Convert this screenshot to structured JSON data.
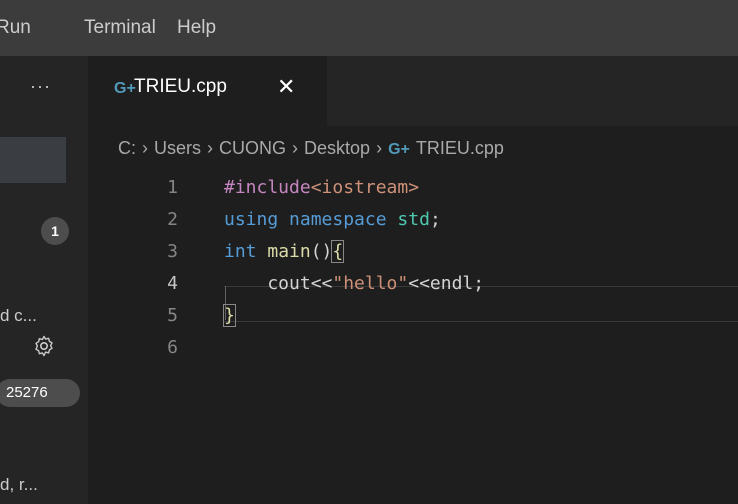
{
  "menubar": {
    "items": [
      "Run",
      "Terminal",
      "Help"
    ]
  },
  "sidebar": {
    "more": "···",
    "badge": "1",
    "trunc1": "d c...",
    "pill": "25276",
    "trunc2": "d, r..."
  },
  "tab": {
    "icon": "G+",
    "label": "TRIEU.cpp",
    "close": "✕"
  },
  "breadcrumb": {
    "parts": [
      "C:",
      "Users",
      "CUONG",
      "Desktop",
      "TRIEU.cpp"
    ],
    "separator": "›",
    "file_icon": "G+"
  },
  "editor": {
    "lines": [
      {
        "number": "1",
        "tokens": [
          {
            "t": "pp",
            "v": "#include"
          },
          {
            "t": "inc",
            "v": "<iostream>"
          }
        ]
      },
      {
        "number": "2",
        "tokens": [
          {
            "t": "kw",
            "v": "using"
          },
          {
            "t": "plain",
            "v": " "
          },
          {
            "t": "kw",
            "v": "namespace"
          },
          {
            "t": "plain",
            "v": " "
          },
          {
            "t": "ns",
            "v": "std"
          },
          {
            "t": "plain",
            "v": ";"
          }
        ]
      },
      {
        "number": "3",
        "tokens": [
          {
            "t": "kw",
            "v": "int"
          },
          {
            "t": "plain",
            "v": " "
          },
          {
            "t": "fn",
            "v": "main"
          },
          {
            "t": "plain",
            "v": "()"
          },
          {
            "t": "bracket",
            "v": "{"
          }
        ]
      },
      {
        "number": "4",
        "tokens": [
          {
            "t": "plain",
            "v": "    cout<<"
          },
          {
            "t": "str",
            "v": "\"hello\""
          },
          {
            "t": "plain",
            "v": "<<endl;"
          }
        ]
      },
      {
        "number": "5",
        "tokens": [
          {
            "t": "bracket",
            "v": "}"
          }
        ]
      },
      {
        "number": "6",
        "tokens": []
      }
    ],
    "active_line": "4"
  },
  "colors": {
    "menubar_bg": "#3c3c3c",
    "editor_bg": "#1e1e1e",
    "sidebar_bg": "#252526",
    "cpp_icon": "#519aba"
  }
}
